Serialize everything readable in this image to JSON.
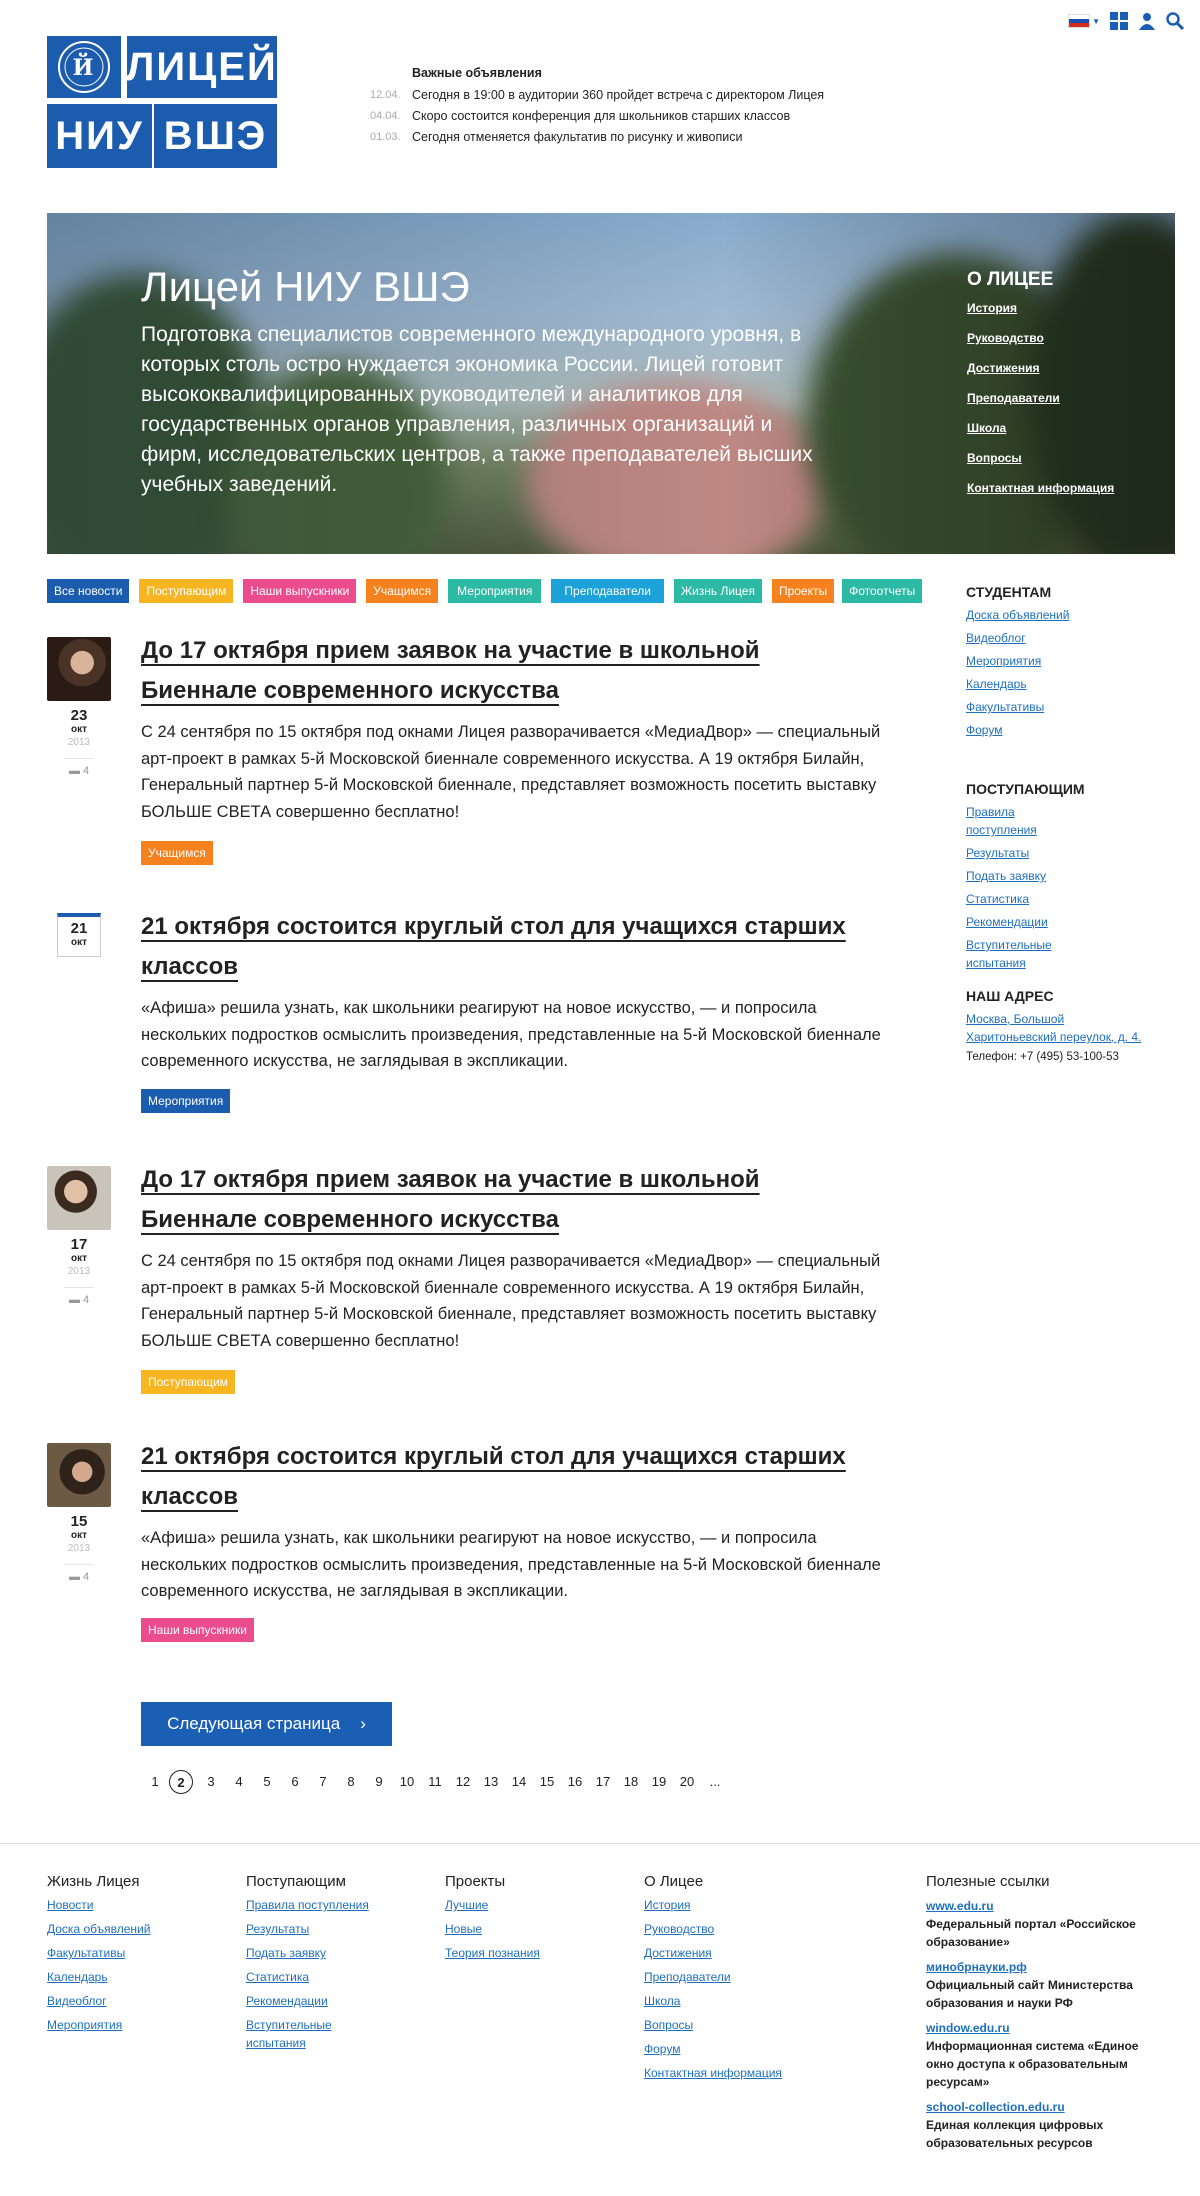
{
  "brand": {
    "tile1": "ЛИЦЕЙ",
    "tile2": "НИУ",
    "tile3": "ВШЭ",
    "color": "#1b5cae"
  },
  "announcements": {
    "title": "Важные объявления",
    "items": [
      {
        "date": "12.04.",
        "text": "Сегодня в 19:00 в аудитории 360 пройдет встреча с директором Лицея"
      },
      {
        "date": "04.04.",
        "text": "Скоро состоится конференция для школьников старших классов"
      },
      {
        "date": "01.03.",
        "text": "Сегодня отменяется факультатив по рисунку и живописи"
      }
    ]
  },
  "topbar": {
    "icons": [
      "flag-ru-icon",
      "grid-icon",
      "user-icon",
      "search-icon"
    ]
  },
  "hero": {
    "title": "Лицей НИУ ВШЭ",
    "text": "Подготовка специалистов современного международного уровня, в которых столь остро нуждается экономика России. Лицей готовит высококвалифицированных руководителей и аналитиков для государственных органов управления, различных организаций и фирм, исследовательских центров, а также преподавателей высших учебных заведений.",
    "menu_title": "О ЛИЦЕЕ",
    "menu": [
      "История",
      "Руководство",
      "Достижения",
      "Преподаватели",
      "Школа",
      "Вопросы",
      "Контактная информация"
    ]
  },
  "tags": [
    {
      "label": "Все новости",
      "color": "#1b5cae"
    },
    {
      "label": "Поступающим",
      "color": "#f7b522"
    },
    {
      "label": "Наши выпускники",
      "color": "#ea4c8e"
    },
    {
      "label": "Учащимся",
      "color": "#f5821f"
    },
    {
      "label": "Мероприятия",
      "color": "#2dbaa5"
    },
    {
      "label": "Преподаватели",
      "color": "#1ca1d8"
    },
    {
      "label": "Жизнь Лицея",
      "color": "#2dbaa5"
    },
    {
      "label": "Проекты",
      "color": "#f5821f"
    },
    {
      "label": "Фотоотчеты",
      "color": "#2dbaa5"
    }
  ],
  "posts": [
    {
      "day": "23",
      "month": "окт",
      "year": "2013",
      "comments": "4",
      "title": "До 17 октября прием заявок на участие в школьной Биеннале современного искусства",
      "body": "С 24 сентября по 15 октября под окнами Лицея разворачивается «МедиаДвор» — специальный арт-проект в рамках 5-й Московской биеннале современного искусства. А 19 октября Билайн, Генеральный партнер 5-й Московской биеннале, представляет возможность посетить выставку БОЛЬШЕ СВЕТА совершенно бесплатно!",
      "tag": "Учащимся",
      "tag_color": "#f5821f"
    },
    {
      "day": "21",
      "month": "окт",
      "title": "21 октября состоится круглый стол для учащихся старших классов",
      "body": "«Афиша» решила узнать, как школьники реагируют на новое искусство, — и попросила нескольких подростков осмыслить произведения, представленные на 5-й Московской биеннале современного искусства, не заглядывая в экспликации.",
      "tag": "Мероприятия",
      "tag_color": "#1b5cae"
    },
    {
      "day": "17",
      "month": "окт",
      "year": "2013",
      "comments": "4",
      "title": "До 17 октября прием заявок на участие в школьной Биеннале современного искусства",
      "body": "С 24 сентября по 15 октября под окнами Лицея разворачивается «МедиаДвор» — специальный арт-проект в рамках 5-й Московской биеннале современного искусства. А 19 октября Билайн, Генеральный партнер 5-й Московской биеннале, представляет возможность посетить выставку БОЛЬШЕ СВЕТА совершенно бесплатно!",
      "tag": "Поступающим",
      "tag_color": "#f7b522"
    },
    {
      "day": "15",
      "month": "окт",
      "year": "2013",
      "comments": "4",
      "title": "21 октября состоится круглый стол для учащихся старших классов",
      "body": "«Афиша» решила узнать, как школьники реагируют на новое искусство, — и попросила нескольких подростков осмыслить произведения, представленные на 5-й Московской биеннале современного искусства, не заглядывая в экспликации.",
      "tag": "Наши выпускники",
      "tag_color": "#ea4c8e"
    }
  ],
  "sidebar": {
    "students_title": "СТУДЕНТАМ",
    "students": [
      "Доска объявлений",
      "Видеоблог",
      "Мероприятия",
      "Календарь",
      "Факультативы",
      "Форум"
    ],
    "applicants_title": "ПОСТУПАЮЩИМ",
    "applicants": [
      "Правила поступления",
      "Результаты",
      "Подать заявку",
      "Статистика",
      "Рекомендации",
      "Вступительные испытания"
    ],
    "address_title": "НАШ АДРЕС",
    "address": "Москва, Большой Харитоньевский переулок, д. 4.",
    "phone": "Телефон: +7 (495) 53-100-53"
  },
  "pager": {
    "next": "Следующая страница",
    "arrow": "›",
    "pages": [
      "1",
      "2",
      "3",
      "4",
      "5",
      "6",
      "7",
      "8",
      "9",
      "10",
      "11",
      "12",
      "13",
      "14",
      "15",
      "16",
      "17",
      "18",
      "19",
      "20",
      "..."
    ],
    "current": "2"
  },
  "footer": {
    "cols": [
      {
        "title": "Жизнь Лицея",
        "links": [
          "Новости",
          "Доска объявлений",
          "Факультативы",
          "Календарь",
          "Видеоблог",
          "Мероприятия"
        ]
      },
      {
        "title": "Поступающим",
        "links": [
          "Правила поступления",
          "Результаты",
          "Подать заявку",
          "Статистика",
          "Рекомендации",
          "Вступительные испытания"
        ]
      },
      {
        "title": "Проекты",
        "links": [
          "Лучшие",
          "Новые",
          "Теория познания"
        ]
      },
      {
        "title": "О Лицее",
        "links": [
          "История",
          "Руководство",
          "Достижения",
          "Преподаватели",
          "Школа",
          "Вопросы",
          "Форум",
          "Контактная информация"
        ]
      }
    ],
    "useful_title": "Полезные ссылки",
    "useful": [
      {
        "url": "www.edu.ru",
        "desc": "Федеральный портал «Российское образование»"
      },
      {
        "url": "минобрнауки.рф",
        "desc": "Официальный сайт Министерства образования и науки РФ"
      },
      {
        "url": "window.edu.ru",
        "desc": "Информационная система «Единое окно доступа к образовательным ресурсам»"
      },
      {
        "url": "school-collection.edu.ru",
        "desc": "Единая коллекция цифровых образовательных ресурсов"
      }
    ]
  }
}
